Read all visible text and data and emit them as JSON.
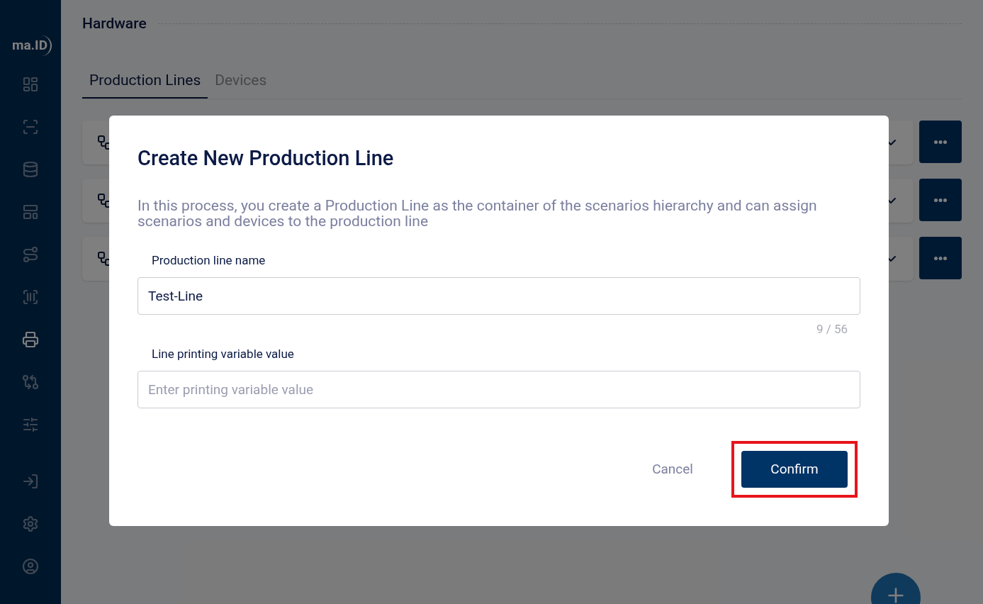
{
  "sidebar": {
    "logo": "ma.ID",
    "items": [
      {
        "selected": false
      },
      {
        "selected": false
      },
      {
        "selected": false
      },
      {
        "selected": false
      },
      {
        "selected": false
      },
      {
        "selected": false
      },
      {
        "selected": true
      },
      {
        "selected": false
      },
      {
        "selected": false
      }
    ],
    "bottom_items": [
      {
        "selected": false
      },
      {
        "selected": false
      },
      {
        "selected": false
      }
    ]
  },
  "page": {
    "title": "Hardware",
    "tabs": [
      {
        "label": "Production Lines",
        "selected": true
      },
      {
        "label": "Devices",
        "selected": false
      }
    ],
    "rows": [
      {
        "expanded": false
      },
      {
        "expanded": false
      },
      {
        "expanded": false
      }
    ]
  },
  "dialog": {
    "title": "Create New Production Line",
    "description": "In this process, you create a Production Line as the container of the scenarios hierarchy and can assign scenarios and devices to the production line",
    "fields": [
      {
        "label": "Production line name",
        "value": "Test-Line",
        "counter": "9 / 56"
      },
      {
        "label": "Line printing variable value",
        "placeholder": "Enter printing variable value"
      }
    ],
    "buttons": [
      {
        "label": "Cancel",
        "kind": "text"
      },
      {
        "label": "Confirm",
        "kind": "primary",
        "highlighted": true
      }
    ]
  }
}
